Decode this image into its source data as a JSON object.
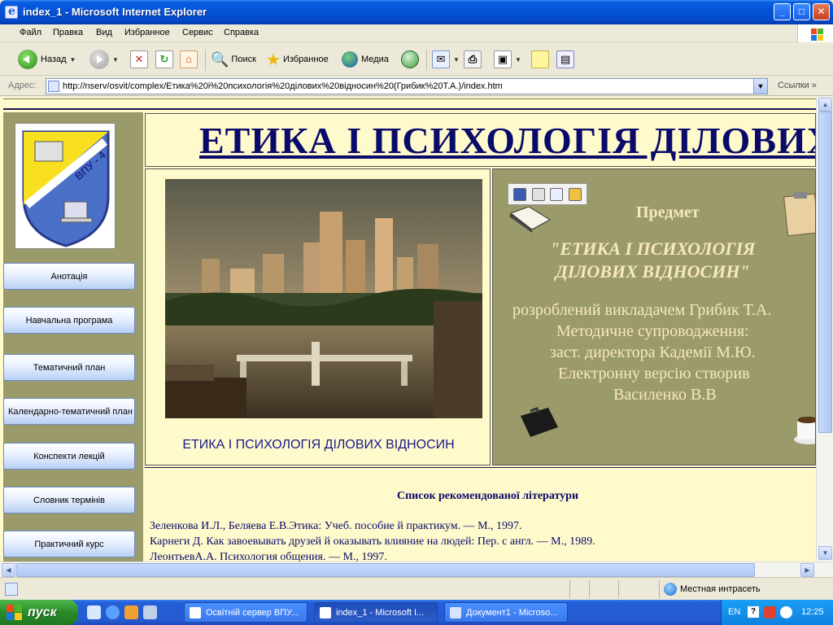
{
  "window": {
    "title": "index_1 - Microsoft Internet Explorer",
    "minimize": "_",
    "maximize": "□",
    "close": "✕"
  },
  "menu": [
    "Файл",
    "Правка",
    "Вид",
    "Избранное",
    "Сервис",
    "Справка"
  ],
  "toolbar": {
    "back": "Назад",
    "search": "Поиск",
    "favorites": "Избранное",
    "media": "Медиа"
  },
  "address": {
    "label": "Адрес:",
    "url": "http://nserv/osvit/complex/Етика%20і%20психологія%20ділових%20відносин%20(Грибик%20Т.А.)/index.htm",
    "links": "Ссылки"
  },
  "page": {
    "heading": "ЕТИКА І ПСИХОЛОГІЯ ДІЛОВИХ ВІДНОСИН",
    "logo_text": "ВПУ - 4",
    "nav": [
      "Анотація",
      "Навчальна програма",
      "Тематичний план",
      "Календарно-тематичний план",
      "Конспекти лекцій",
      "Словник термінів",
      "Практичний курс"
    ],
    "image_caption": "ЕТИКА І ПСИХОЛОГІЯ ДІЛОВИХ ВІДНОСИН",
    "info": {
      "subject_label": "Предмет",
      "subject_line1": "\"ЕТИКА І ПСИХОЛОГІЯ",
      "subject_line2": "ДІЛОВИХ ВІДНОСИН\"",
      "credit_line1": "розроблений  викладачем  Грибик Т.А.",
      "credit_line2": "Методичне супроводження:",
      "credit_line3": "заст. директора Кадемії М.Ю.",
      "credit_line4": "Електронну версію створив",
      "credit_line5": "Василенко В.В"
    },
    "literature": {
      "title": "Список рекомендованої літератури",
      "items": [
        "Зеленкова И.Л., Беляева Е.В.Этика: Учеб. пособие й практикум. — М., 1997.",
        "Карнеги Д. Как завоевывать друзей й оказывать влияние на людей: Пер. с англ. — М., 1989.",
        "ЛеонтьевА.А. Психология общения. — М., 1997."
      ]
    }
  },
  "status": {
    "zone": "Местная интрасеть"
  },
  "taskbar": {
    "start": "пуск",
    "tasks": [
      "Освітній сервер ВПУ...",
      "index_1 - Microsoft I...",
      "Документ1 - Microso..."
    ],
    "lang": "EN",
    "clock": "12:25"
  },
  "colors": {
    "page_bg": "#fffacc",
    "olive": "#9a9a6a",
    "heading": "#0a0a6a",
    "xp_blue": "#0554d8"
  }
}
